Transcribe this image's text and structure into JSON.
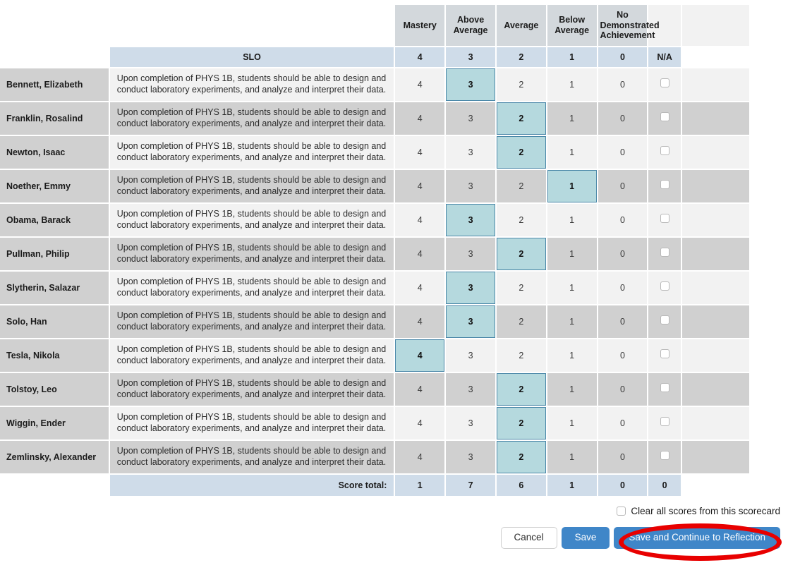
{
  "table": {
    "columns": [
      {
        "key": "mastery",
        "header": "Mastery",
        "value": "4"
      },
      {
        "key": "above_average",
        "header": "Above\nAverage",
        "value": "3"
      },
      {
        "key": "average",
        "header": "Average",
        "value": "2"
      },
      {
        "key": "below_average",
        "header": "Below\nAverage",
        "value": "1"
      },
      {
        "key": "no_demonstrated",
        "header": "No\nDemonstrated\nAchievement",
        "value": "0"
      },
      {
        "key": "na",
        "header": "",
        "value": "N/A"
      }
    ],
    "slo_header": "SLO",
    "slo_text": "Upon completion of PHYS 1B, students should be able to design and conduct laboratory experiments, and analyze and interpret their data.",
    "score_values": [
      "4",
      "3",
      "2",
      "1",
      "0"
    ],
    "rows": [
      {
        "name": "Bennett, Elizabeth",
        "selected": "3",
        "na_checked": false
      },
      {
        "name": "Franklin, Rosalind",
        "selected": "2",
        "na_checked": false
      },
      {
        "name": "Newton, Isaac",
        "selected": "2",
        "na_checked": false
      },
      {
        "name": "Noether, Emmy",
        "selected": "1",
        "na_checked": false
      },
      {
        "name": "Obama, Barack",
        "selected": "3",
        "na_checked": false
      },
      {
        "name": "Pullman, Philip",
        "selected": "2",
        "na_checked": false
      },
      {
        "name": "Slytherin, Salazar",
        "selected": "3",
        "na_checked": false
      },
      {
        "name": "Solo, Han",
        "selected": "3",
        "na_checked": false
      },
      {
        "name": "Tesla, Nikola",
        "selected": "4",
        "na_checked": false
      },
      {
        "name": "Tolstoy, Leo",
        "selected": "2",
        "na_checked": false
      },
      {
        "name": "Wiggin, Ender",
        "selected": "2",
        "na_checked": false
      },
      {
        "name": "Zemlinsky, Alexander",
        "selected": "2",
        "na_checked": false
      }
    ],
    "totals": {
      "label": "Score total:",
      "values": [
        "1",
        "7",
        "6",
        "1",
        "0",
        "0"
      ]
    }
  },
  "footer": {
    "clear_all_label": "Clear all scores from this scorecard",
    "clear_all_checked": false,
    "cancel_label": "Cancel",
    "save_label": "Save",
    "continue_label": "Save and Continue to Reflection"
  },
  "annotation": {
    "shape": "ellipse",
    "color": "#e80000",
    "target": "Save and Continue to Reflection"
  },
  "colors": {
    "header_bg": "#d3d8dc",
    "legend_bg": "#cfdce9",
    "row_odd": "#f2f2f2",
    "row_even": "#d0d0d0",
    "name_bg": "#d0d0d0",
    "selected_bg": "#b5d9de",
    "selected_border": "#4a87a8",
    "button_blue": "#3f86c8",
    "annotation_red": "#e80000"
  }
}
